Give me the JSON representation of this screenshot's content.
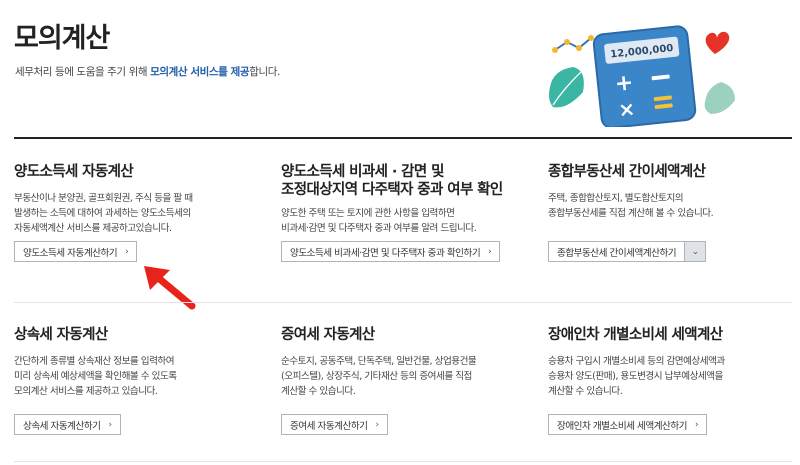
{
  "page": {
    "title": "모의계산",
    "desc_prefix": "세무처리 등에 도움을 주기 위해 ",
    "desc_highlight": "모의계산 서비스를 제공",
    "desc_suffix": "합니다.",
    "illustration_value": "12,000,000"
  },
  "cards": [
    {
      "title_line1": "양도소득세 자동계산",
      "title_line2": "",
      "desc": [
        "부동산이나 분양권, 골프회원권, 주식 등을 팔 때",
        "발생하는 소득에 대하여 과세하는 양도소득세의",
        "자동세액계산 서비스를 제공하고있습니다."
      ],
      "button": "양도소득세 자동계산하기"
    },
    {
      "title_line1": "양도소득세 비과세 · 감면 및",
      "title_line2": "조정대상지역 다주택자 중과 여부 확인",
      "desc": [
        "양도한 주택 또는 토지에 관한 사항을 입력하면",
        "비과세·감면 및 다주택자 중과 여부를 알려 드립니다."
      ],
      "button": "양도소득세 비과세·감면 및 다주택자 중과 확인하기"
    },
    {
      "title_line1": "종합부동산세 간이세액계산",
      "title_line2": "",
      "desc": [
        "주택, 종합합산토지, 별도합산토지의",
        "종합부동산세를 직접 계산해 볼 수 있습니다."
      ],
      "button": "종합부동산세 간이세액계산하기"
    },
    {
      "title_line1": "상속세 자동계산",
      "title_line2": "",
      "desc": [
        "간단하게 종류별 상속재산 정보를 입력하여",
        "미리 상속세 예상세액을 확인해볼 수 있도록",
        "모의계산 서비스를 제공하고 있습니다."
      ],
      "button": "상속세 자동계산하기"
    },
    {
      "title_line1": "증여세 자동계산",
      "title_line2": "",
      "desc": [
        "순수토지, 공동주택, 단독주택, 일반건물, 상업용건물",
        "(오피스텔), 상장주식, 기타재산 등의 증여세를 직접",
        "계산할 수 있습니다."
      ],
      "button": "증여세 자동계산하기"
    },
    {
      "title_line1": "장애인차 개별소비세 세액계산",
      "title_line2": "",
      "desc": [
        "승용차 구입시 개별소비세 등의 감면예상세액과",
        "승용차 양도(판매), 용도변경시 납부예상세액을",
        "계산할 수 있습니다."
      ],
      "button": "장애인차 개별소비세 세액계산하기"
    }
  ],
  "colors": {
    "accent": "#1f5fa8",
    "arrow": "#e8231c",
    "calculator": "#3b86c8"
  },
  "icons": {
    "chevron": "›",
    "dropdown": "⌄"
  }
}
